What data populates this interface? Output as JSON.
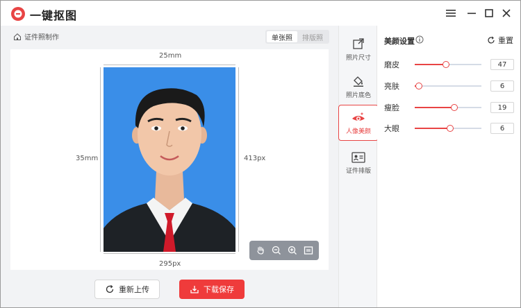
{
  "app": {
    "title": "一键抠图"
  },
  "window": {
    "menu_icon": "hamburger-menu-icon",
    "minimize_icon": "minimize-icon",
    "maximize_icon": "maximize-icon",
    "close_icon": "close-icon"
  },
  "breadcrumb": {
    "label": "证件照制作",
    "icon": "home-icon"
  },
  "view_toggle": {
    "options": [
      "单张照",
      "排版照"
    ],
    "selected": "单张照"
  },
  "canvas": {
    "width_mm": "25mm",
    "height_mm": "35mm",
    "height_px": "413px",
    "width_px": "295px"
  },
  "tools": [
    "hand-pan-icon",
    "zoom-out-icon",
    "zoom-in-icon",
    "fit-screen-icon"
  ],
  "actions": {
    "reupload": "重新上传",
    "download": "下载保存"
  },
  "nav": [
    {
      "label": "照片尺寸",
      "icon": "resize-icon"
    },
    {
      "label": "照片底色",
      "icon": "paint-bucket-icon"
    },
    {
      "label": "人像美颜",
      "icon": "beauty-eye-icon",
      "active": true
    },
    {
      "label": "证件排版",
      "icon": "id-card-icon"
    }
  ],
  "beauty": {
    "title": "美颜设置",
    "reset": "重置",
    "sliders": [
      {
        "label": "磨皮",
        "value": "47",
        "fraction": 0.47
      },
      {
        "label": "亮肤",
        "value": "6",
        "fraction": 0.06
      },
      {
        "label": "瘦脸",
        "value": "19",
        "fraction": 0.59
      },
      {
        "label": "大眼",
        "value": "6",
        "fraction": 0.53
      }
    ]
  },
  "colors": {
    "accent": "#e84444",
    "photo_bg": "#3a8ee8"
  }
}
